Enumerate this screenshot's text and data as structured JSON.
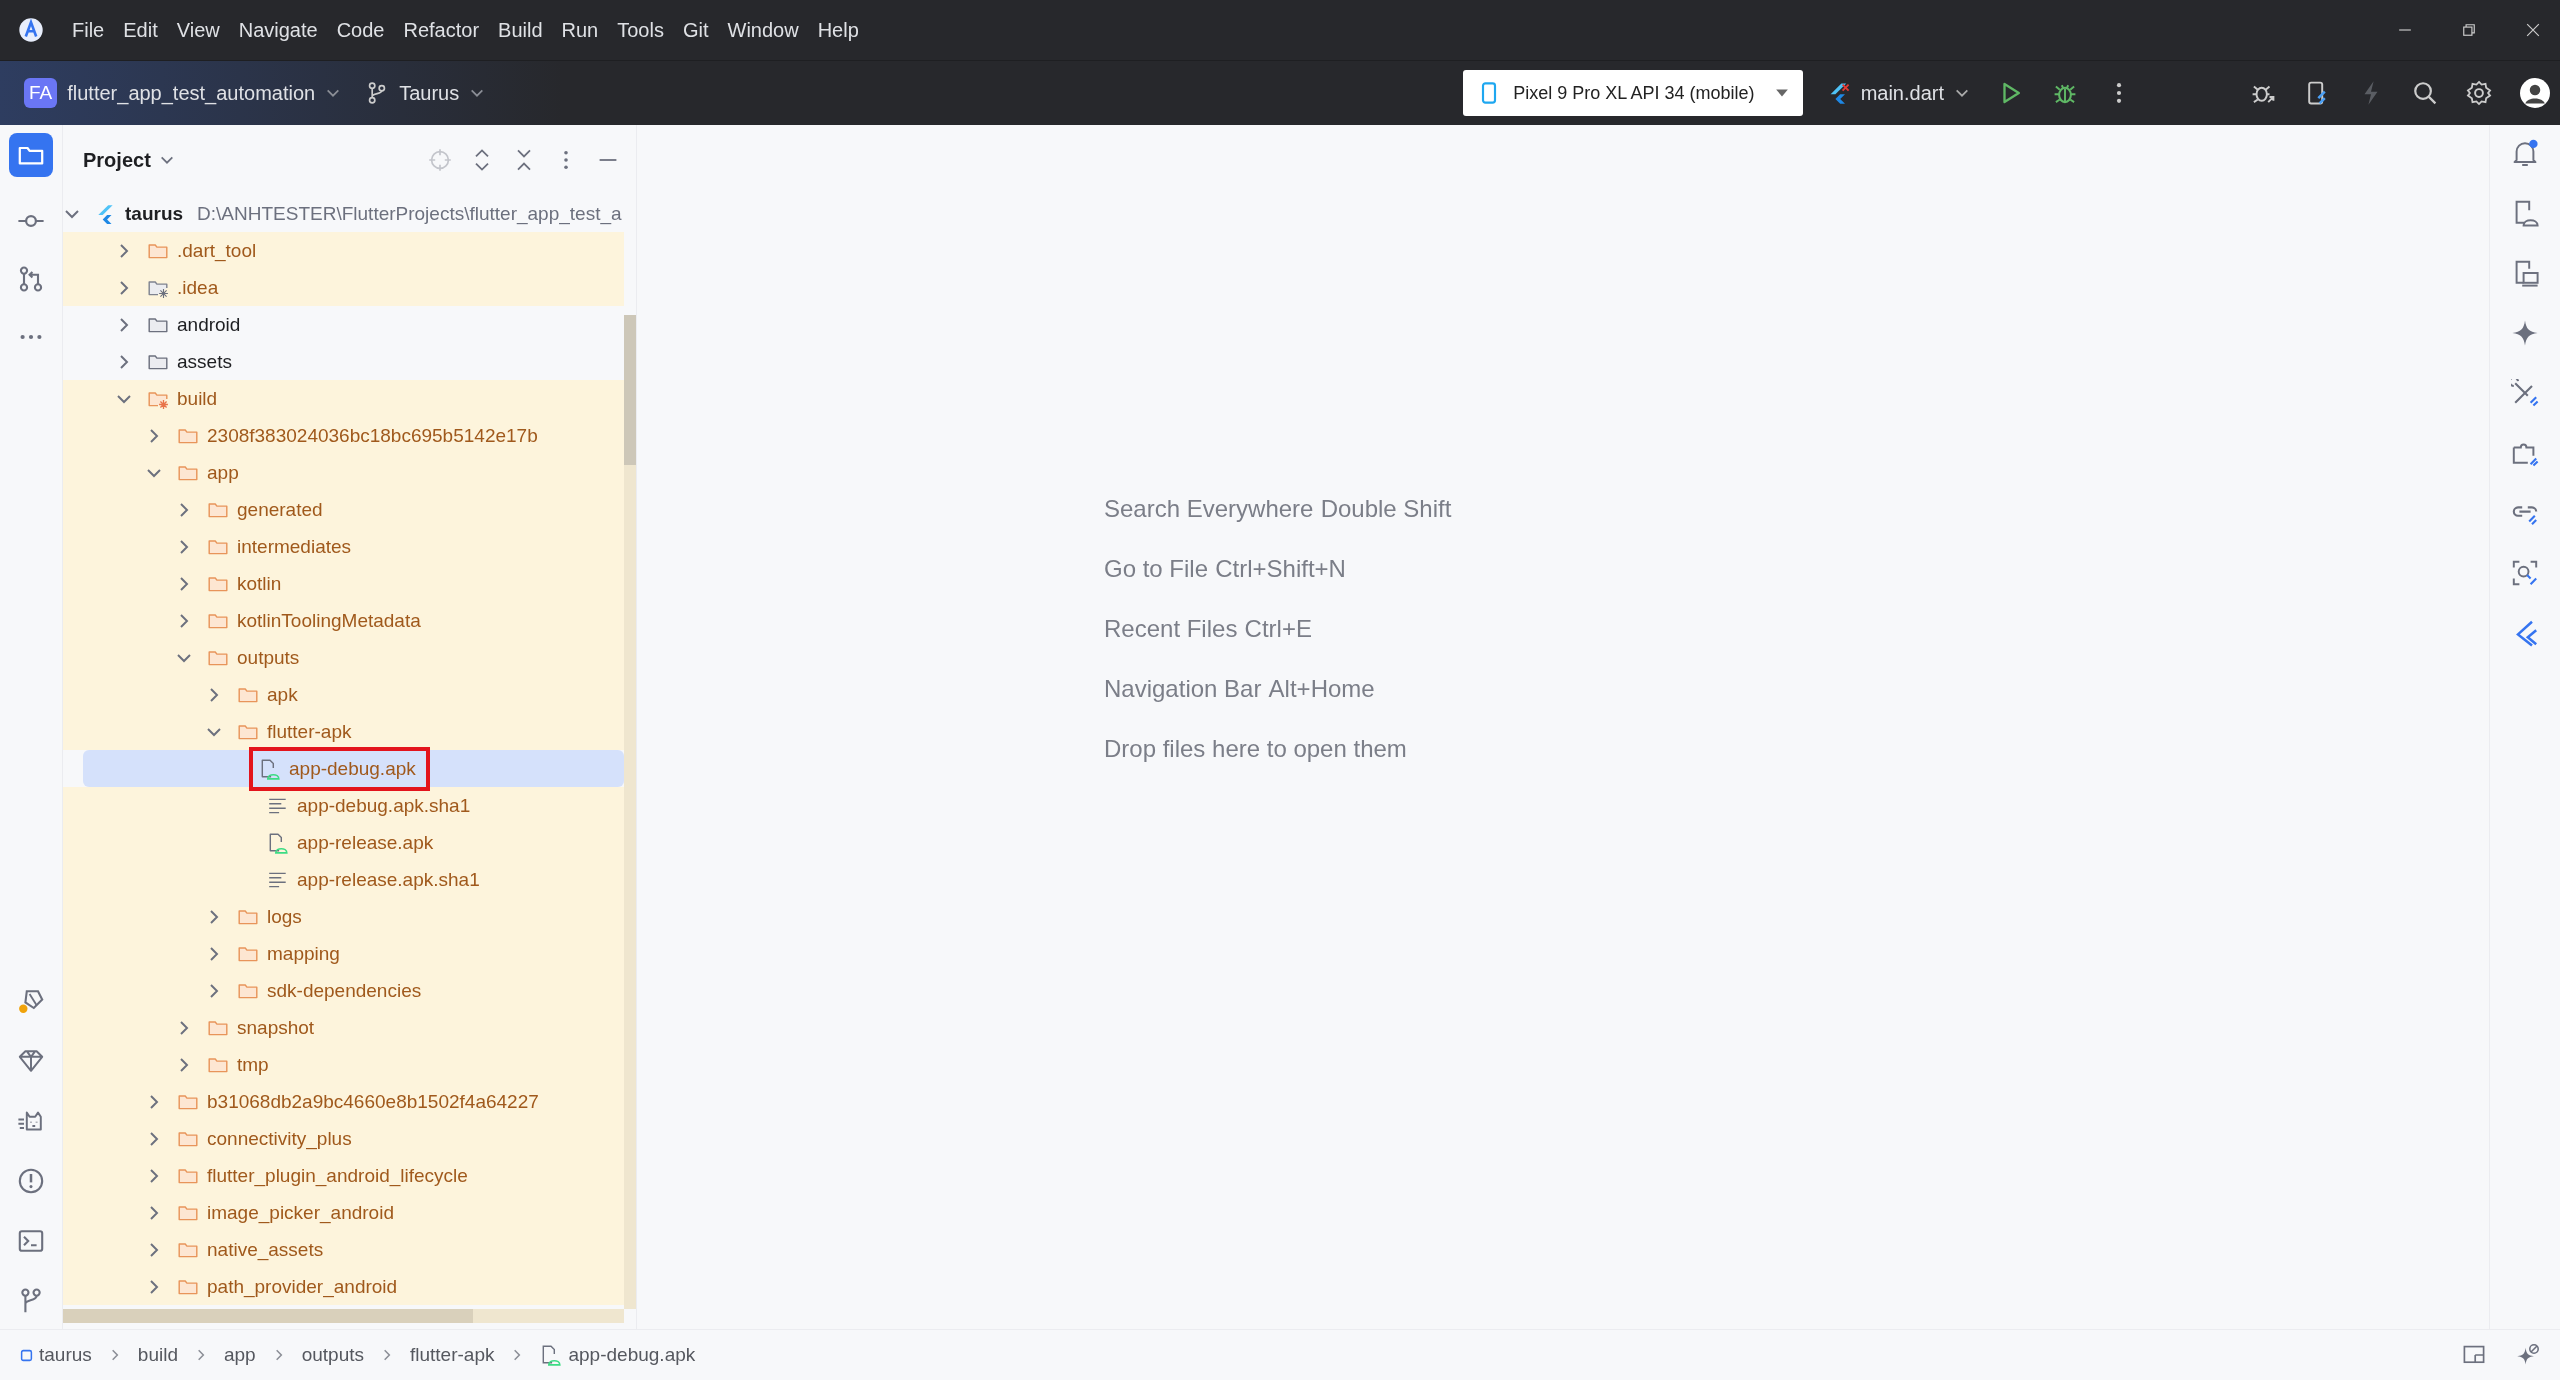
{
  "menu": [
    "File",
    "Edit",
    "View",
    "Navigate",
    "Code",
    "Refactor",
    "Build",
    "Run",
    "Tools",
    "Git",
    "Window",
    "Help"
  ],
  "toolbar": {
    "project_badge": "FA",
    "project_name": "flutter_app_test_automation",
    "branch": "Taurus",
    "device": "Pixel 9 Pro XL API 34 (mobile)",
    "run_config": "main.dart"
  },
  "panel": {
    "title": "Project"
  },
  "project_tree": [
    {
      "label": "taurus",
      "path": "D:\\ANHTESTER\\FlutterProjects\\flutter_app_test_a",
      "kind": "flutter-project",
      "ignored": false,
      "selected": false,
      "expanded": true,
      "children": [
        {
          "label": ".dart_tool",
          "kind": "folder",
          "ignored": true,
          "selected": false,
          "expanded": false
        },
        {
          "label": ".idea",
          "kind": "config-folder",
          "ignored": true,
          "selected": false,
          "expanded": false
        },
        {
          "label": "android",
          "kind": "folder",
          "ignored": false,
          "selected": false,
          "expanded": false
        },
        {
          "label": "assets",
          "kind": "folder",
          "ignored": false,
          "selected": false,
          "expanded": false
        },
        {
          "label": "build",
          "kind": "excluded-folder",
          "ignored": true,
          "selected": false,
          "expanded": true,
          "children": [
            {
              "label": "2308f383024036bc18bc695b5142e17b",
              "kind": "folder",
              "ignored": true,
              "selected": false,
              "expanded": false
            },
            {
              "label": "app",
              "kind": "folder",
              "ignored": true,
              "selected": false,
              "expanded": true,
              "children": [
                {
                  "label": "generated",
                  "kind": "folder",
                  "ignored": true,
                  "selected": false,
                  "expanded": false
                },
                {
                  "label": "intermediates",
                  "kind": "folder",
                  "ignored": true,
                  "selected": false,
                  "expanded": false
                },
                {
                  "label": "kotlin",
                  "kind": "folder",
                  "ignored": true,
                  "selected": false,
                  "expanded": false
                },
                {
                  "label": "kotlinToolingMetadata",
                  "kind": "folder",
                  "ignored": true,
                  "selected": false,
                  "expanded": false
                },
                {
                  "label": "outputs",
                  "kind": "folder",
                  "ignored": true,
                  "selected": false,
                  "expanded": true,
                  "children": [
                    {
                      "label": "apk",
                      "kind": "folder",
                      "ignored": true,
                      "selected": false,
                      "expanded": false
                    },
                    {
                      "label": "flutter-apk",
                      "kind": "folder",
                      "ignored": true,
                      "selected": false,
                      "expanded": true,
                      "children": [
                        {
                          "label": "app-debug.apk",
                          "kind": "apk",
                          "ignored": true,
                          "selected": true,
                          "outlined": true
                        },
                        {
                          "label": "app-debug.apk.sha1",
                          "kind": "text",
                          "ignored": true,
                          "selected": false,
                          "outlined": false
                        },
                        {
                          "label": "app-release.apk",
                          "kind": "apk",
                          "ignored": true,
                          "selected": false,
                          "outlined": false
                        },
                        {
                          "label": "app-release.apk.sha1",
                          "kind": "text",
                          "ignored": true,
                          "selected": false,
                          "outlined": false
                        }
                      ]
                    },
                    {
                      "label": "logs",
                      "kind": "folder",
                      "ignored": true,
                      "selected": false,
                      "expanded": false
                    },
                    {
                      "label": "mapping",
                      "kind": "folder",
                      "ignored": true,
                      "selected": false,
                      "expanded": false
                    },
                    {
                      "label": "sdk-dependencies",
                      "kind": "folder",
                      "ignored": true,
                      "selected": false,
                      "expanded": false
                    }
                  ]
                },
                {
                  "label": "snapshot",
                  "kind": "folder",
                  "ignored": true,
                  "selected": false,
                  "expanded": false
                },
                {
                  "label": "tmp",
                  "kind": "folder",
                  "ignored": true,
                  "selected": false,
                  "expanded": false
                }
              ]
            },
            {
              "label": "b31068db2a9bc4660e8b1502f4a64227",
              "kind": "folder",
              "ignored": true,
              "selected": false,
              "expanded": false
            },
            {
              "label": "connectivity_plus",
              "kind": "folder",
              "ignored": true,
              "selected": false,
              "expanded": false
            },
            {
              "label": "flutter_plugin_android_lifecycle",
              "kind": "folder",
              "ignored": true,
              "selected": false,
              "expanded": false
            },
            {
              "label": "image_picker_android",
              "kind": "folder",
              "ignored": true,
              "selected": false,
              "expanded": false
            },
            {
              "label": "native_assets",
              "kind": "folder",
              "ignored": true,
              "selected": false,
              "expanded": false
            },
            {
              "label": "path_provider_android",
              "kind": "folder",
              "ignored": true,
              "selected": false,
              "expanded": false
            }
          ]
        }
      ]
    }
  ],
  "editor_hints": [
    {
      "action": "Search Everywhere",
      "shortcut": "Double Shift"
    },
    {
      "action": "Go to File",
      "shortcut": "Ctrl+Shift+N"
    },
    {
      "action": "Recent Files",
      "shortcut": "Ctrl+E"
    },
    {
      "action": "Navigation Bar",
      "shortcut": "Alt+Home"
    },
    {
      "action": "Drop files here to open them"
    }
  ],
  "breadcrumbs": [
    {
      "label": "taurus",
      "kind": "module"
    },
    {
      "label": "build",
      "kind": "folder"
    },
    {
      "label": "app",
      "kind": "folder"
    },
    {
      "label": "outputs",
      "kind": "folder"
    },
    {
      "label": "flutter-apk",
      "kind": "folder"
    },
    {
      "label": "app-debug.apk",
      "kind": "apk"
    }
  ]
}
